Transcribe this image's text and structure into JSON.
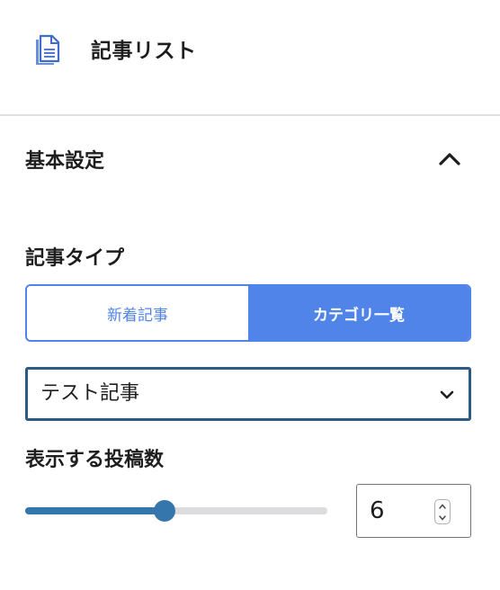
{
  "header": {
    "icon": "document-icon",
    "title": "記事リスト"
  },
  "section": {
    "title": "基本設定",
    "toggle_icon": "chevron-up-icon"
  },
  "article_type": {
    "label": "記事タイプ",
    "options": [
      "新着記事",
      "カテゴリ一覧"
    ],
    "selected": "カテゴリ一覧"
  },
  "category_select": {
    "value": "テスト記事",
    "icon": "chevron-down-icon"
  },
  "post_count": {
    "label": "表示する投稿数",
    "value": "6",
    "slider_fraction": 0.46
  },
  "colors": {
    "accent": "#5084e8",
    "slider": "#3577ad",
    "select_border": "#2b5b84"
  }
}
